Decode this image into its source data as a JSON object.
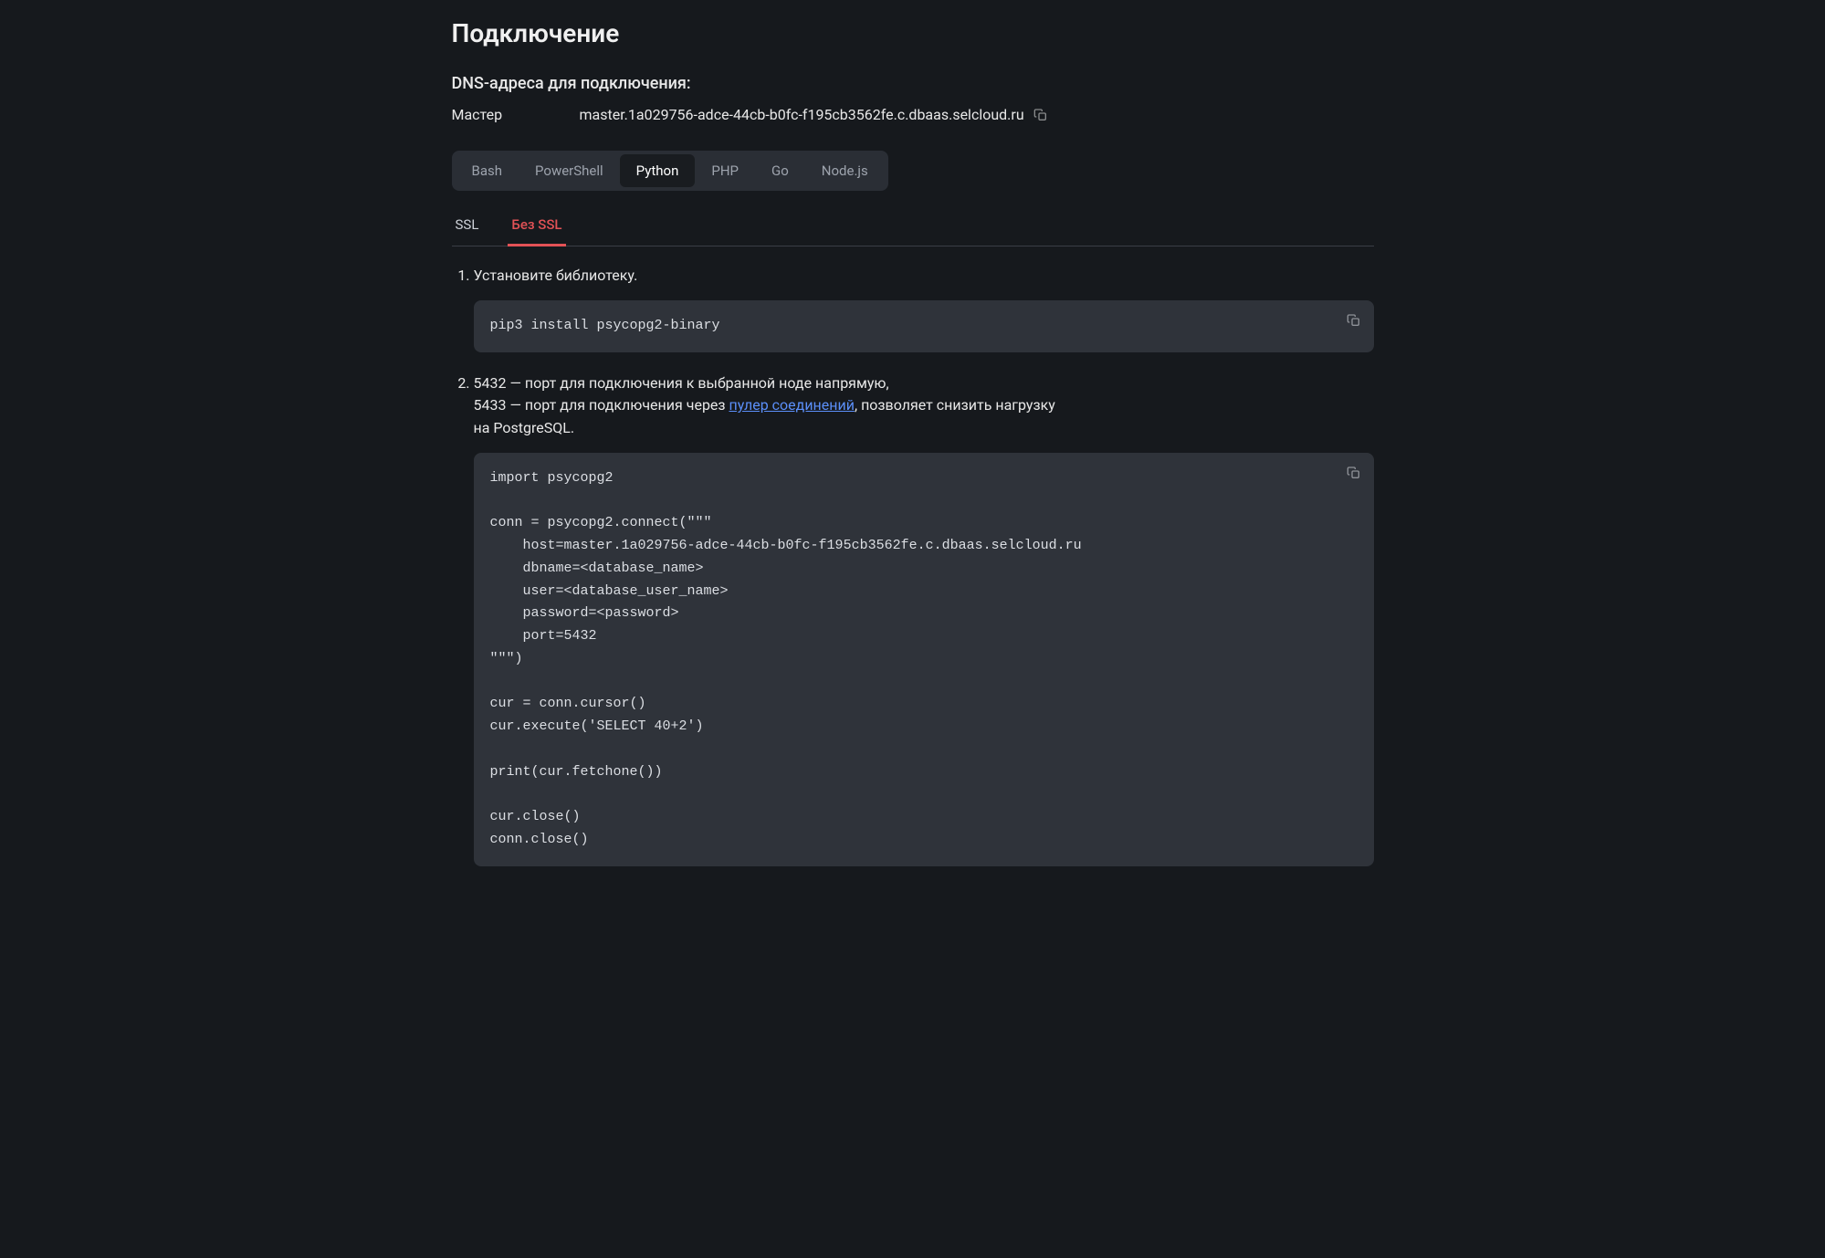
{
  "page_title": "Подключение",
  "dns_heading": "DNS-адреса для подключения:",
  "dns": {
    "label": "Мастер",
    "value": "master.1a029756-adce-44cb-b0fc-f195cb3562fe.c.dbaas.selcloud.ru"
  },
  "lang_tabs": {
    "bash": "Bash",
    "powershell": "PowerShell",
    "python": "Python",
    "php": "PHP",
    "go": "Go",
    "nodejs": "Node.js"
  },
  "ssl_tabs": {
    "ssl": "SSL",
    "no_ssl": "Без SSL"
  },
  "steps": {
    "s1": {
      "text": "Установите библиотеку.",
      "code": "pip3 install psycopg2-binary"
    },
    "s2": {
      "line1_prefix": "5432 — порт для подключения к выбранной ноде напрямую,",
      "line2_prefix": "5433 — порт для подключения через ",
      "line2_link": "пулер соединений",
      "line2_suffix": ", позволяет снизить нагрузку",
      "line3": "на PostgreSQL.",
      "code": "import psycopg2\n\nconn = psycopg2.connect(\"\"\"\n    host=master.1a029756-adce-44cb-b0fc-f195cb3562fe.c.dbaas.selcloud.ru\n    dbname=<database_name>\n    user=<database_user_name>\n    password=<password>\n    port=5432\n\"\"\")\n\ncur = conn.cursor()\ncur.execute('SELECT 40+2')\n\nprint(cur.fetchone())\n\ncur.close()\nconn.close()"
    }
  }
}
